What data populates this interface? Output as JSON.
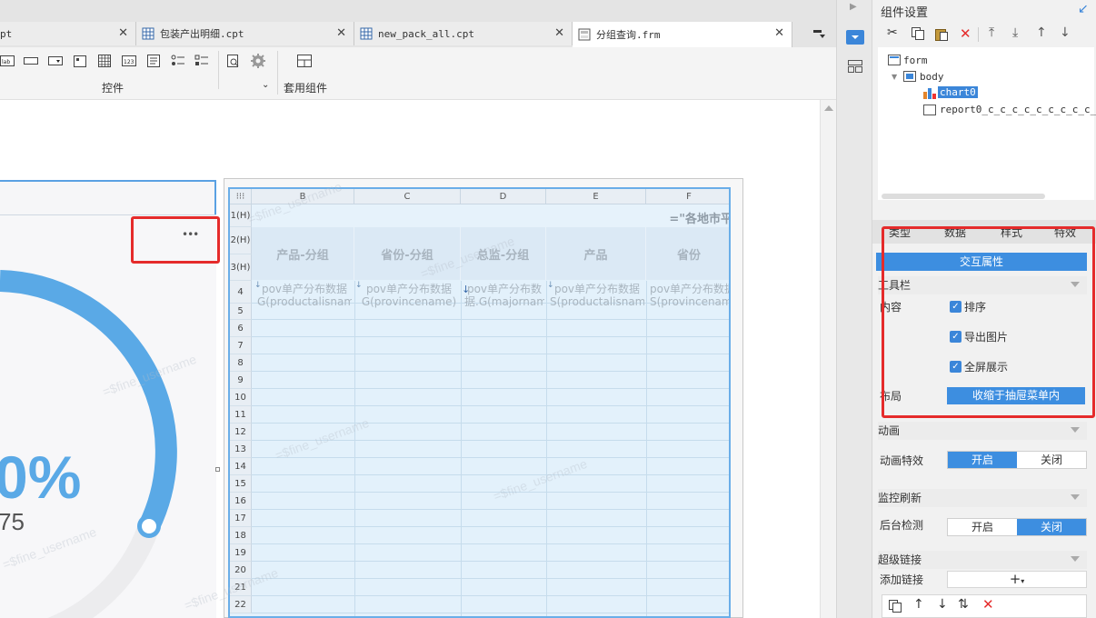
{
  "tabs": [
    {
      "label": "pt"
    },
    {
      "label": "包装产出明细.cpt"
    },
    {
      "label": "new_pack_all.cpt"
    },
    {
      "label": "分组查询.frm"
    }
  ],
  "toolbar": {
    "group_controls": "控件",
    "group_apply": "套用组件"
  },
  "chart": {
    "percent": "0%",
    "value": "75",
    "more": "•••"
  },
  "watermark": "=$fine_username",
  "grid": {
    "columns": [
      "B",
      "C",
      "D",
      "E",
      "F"
    ],
    "rows": [
      "1(H)",
      "2(H)",
      "3(H)",
      "4",
      "5",
      "6",
      "7",
      "8",
      "9",
      "10",
      "11",
      "12",
      "13",
      "14",
      "15",
      "16",
      "17",
      "18",
      "19",
      "20",
      "21",
      "22"
    ],
    "title_formula": "=\"各地市平",
    "headers": [
      "产品-分组",
      "省份-分组",
      "总监-分组",
      "产品",
      "省份"
    ],
    "cells": [
      "pov单产分布数据G(productalisname)",
      "pov单产分布数据G(provincename)",
      "pov单产分布数据.G(majorname)",
      "pov单产分布数据S(productalisname)",
      "pov单产分布数据S(provincename)"
    ]
  },
  "panel": {
    "title": "组件设置",
    "tree": {
      "root": "form",
      "body": "body",
      "chart": "chart0",
      "report": "report0_c_c_c_c_c_c_c_c_c_c"
    },
    "tabs": [
      "类型",
      "数据",
      "样式",
      "特效"
    ],
    "interactive_btn": "交互属性",
    "toolbar_section": "工具栏",
    "content_label": "内容",
    "checks": [
      "排序",
      "导出图片",
      "全屏展示"
    ],
    "layout_label": "布局",
    "layout_value": "收缩于抽屉菜单内",
    "anim_section": "动画",
    "anim_label": "动画特效",
    "anim_on": "开启",
    "anim_off": "关闭",
    "monitor_section": "监控刷新",
    "monitor_label": "后台检测",
    "monitor_on": "开启",
    "monitor_off": "关闭",
    "link_section": "超级链接",
    "add_link": "添加链接"
  },
  "colors": {
    "accent": "#3d8ee0",
    "highlight": "#e52b2b",
    "chart_blue": "#5aa9e6"
  }
}
